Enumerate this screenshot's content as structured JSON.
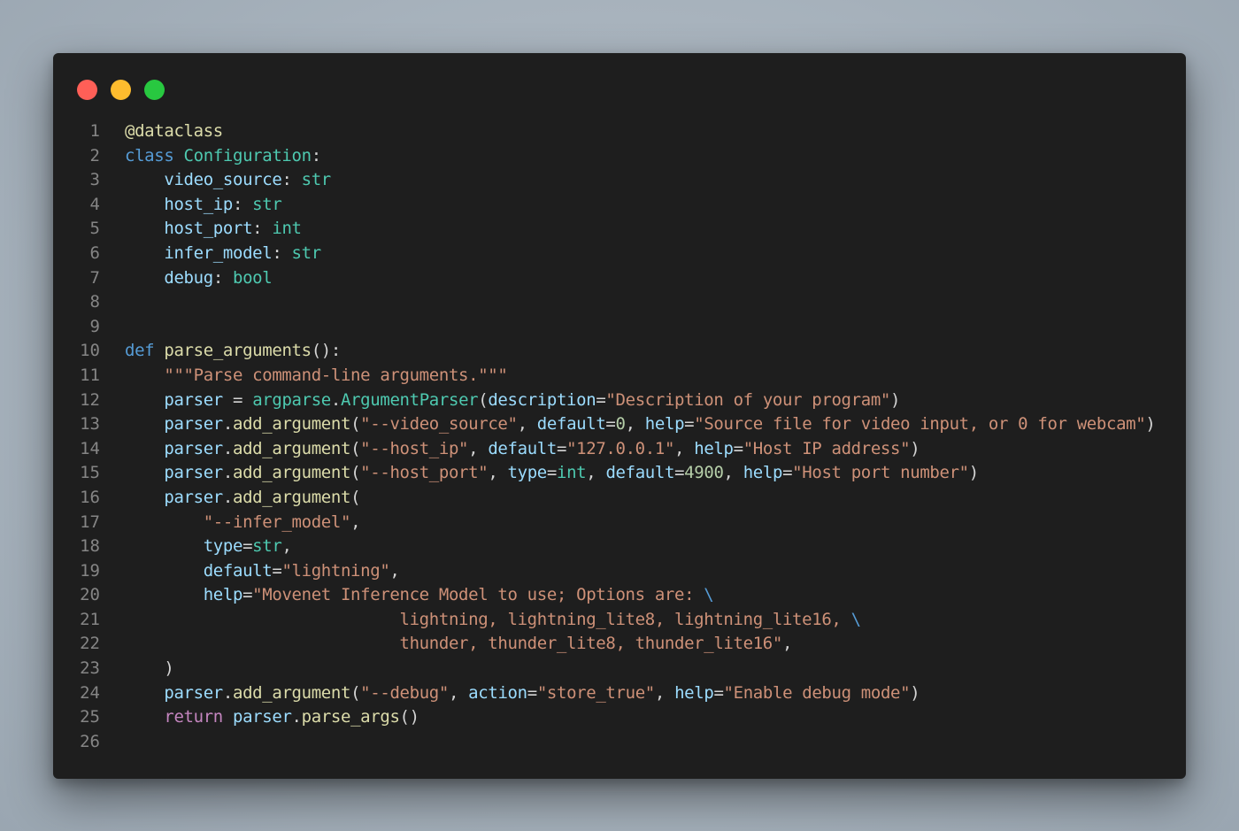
{
  "window": {
    "controls": [
      {
        "name": "close",
        "color": "#ff5f57"
      },
      {
        "name": "minimize",
        "color": "#febc2e"
      },
      {
        "name": "maximize",
        "color": "#28c840"
      }
    ]
  },
  "editor": {
    "language": "python",
    "lines": [
      {
        "n": "1",
        "tokens": [
          [
            "deco",
            "@dataclass"
          ]
        ]
      },
      {
        "n": "2",
        "tokens": [
          [
            "kw",
            "class"
          ],
          [
            "plain",
            " "
          ],
          [
            "cls",
            "Configuration"
          ],
          [
            "plain",
            ":"
          ]
        ]
      },
      {
        "n": "3",
        "tokens": [
          [
            "plain",
            "    "
          ],
          [
            "var",
            "video_source"
          ],
          [
            "plain",
            ": "
          ],
          [
            "type",
            "str"
          ]
        ]
      },
      {
        "n": "4",
        "tokens": [
          [
            "plain",
            "    "
          ],
          [
            "var",
            "host_ip"
          ],
          [
            "plain",
            ": "
          ],
          [
            "type",
            "str"
          ]
        ]
      },
      {
        "n": "5",
        "tokens": [
          [
            "plain",
            "    "
          ],
          [
            "var",
            "host_port"
          ],
          [
            "plain",
            ": "
          ],
          [
            "type",
            "int"
          ]
        ]
      },
      {
        "n": "6",
        "tokens": [
          [
            "plain",
            "    "
          ],
          [
            "var",
            "infer_model"
          ],
          [
            "plain",
            ": "
          ],
          [
            "type",
            "str"
          ]
        ]
      },
      {
        "n": "7",
        "tokens": [
          [
            "plain",
            "    "
          ],
          [
            "var",
            "debug"
          ],
          [
            "plain",
            ": "
          ],
          [
            "type",
            "bool"
          ]
        ]
      },
      {
        "n": "8",
        "tokens": []
      },
      {
        "n": "9",
        "tokens": []
      },
      {
        "n": "10",
        "tokens": [
          [
            "kw",
            "def"
          ],
          [
            "plain",
            " "
          ],
          [
            "fn",
            "parse_arguments"
          ],
          [
            "plain",
            "():"
          ]
        ]
      },
      {
        "n": "11",
        "tokens": [
          [
            "plain",
            "    "
          ],
          [
            "str",
            "\"\"\"Parse command-line arguments.\"\"\""
          ]
        ]
      },
      {
        "n": "12",
        "tokens": [
          [
            "plain",
            "    "
          ],
          [
            "var",
            "parser"
          ],
          [
            "plain",
            " = "
          ],
          [
            "cls",
            "argparse"
          ],
          [
            "plain",
            "."
          ],
          [
            "cls",
            "ArgumentParser"
          ],
          [
            "plain",
            "("
          ],
          [
            "var",
            "description"
          ],
          [
            "plain",
            "="
          ],
          [
            "str",
            "\"Description of your program\""
          ],
          [
            "plain",
            ")"
          ]
        ]
      },
      {
        "n": "13",
        "tokens": [
          [
            "plain",
            "    "
          ],
          [
            "var",
            "parser"
          ],
          [
            "plain",
            "."
          ],
          [
            "fn",
            "add_argument"
          ],
          [
            "plain",
            "("
          ],
          [
            "str",
            "\"--video_source\""
          ],
          [
            "plain",
            ", "
          ],
          [
            "var",
            "default"
          ],
          [
            "plain",
            "="
          ],
          [
            "num",
            "0"
          ],
          [
            "plain",
            ", "
          ],
          [
            "var",
            "help"
          ],
          [
            "plain",
            "="
          ],
          [
            "str",
            "\"Source file for video input, or 0 for webcam\""
          ],
          [
            "plain",
            ")"
          ]
        ]
      },
      {
        "n": "14",
        "tokens": [
          [
            "plain",
            "    "
          ],
          [
            "var",
            "parser"
          ],
          [
            "plain",
            "."
          ],
          [
            "fn",
            "add_argument"
          ],
          [
            "plain",
            "("
          ],
          [
            "str",
            "\"--host_ip\""
          ],
          [
            "plain",
            ", "
          ],
          [
            "var",
            "default"
          ],
          [
            "plain",
            "="
          ],
          [
            "str",
            "\"127.0.0.1\""
          ],
          [
            "plain",
            ", "
          ],
          [
            "var",
            "help"
          ],
          [
            "plain",
            "="
          ],
          [
            "str",
            "\"Host IP address\""
          ],
          [
            "plain",
            ")"
          ]
        ]
      },
      {
        "n": "15",
        "tokens": [
          [
            "plain",
            "    "
          ],
          [
            "var",
            "parser"
          ],
          [
            "plain",
            "."
          ],
          [
            "fn",
            "add_argument"
          ],
          [
            "plain",
            "("
          ],
          [
            "str",
            "\"--host_port\""
          ],
          [
            "plain",
            ", "
          ],
          [
            "var",
            "type"
          ],
          [
            "plain",
            "="
          ],
          [
            "type",
            "int"
          ],
          [
            "plain",
            ", "
          ],
          [
            "var",
            "default"
          ],
          [
            "plain",
            "="
          ],
          [
            "num",
            "4900"
          ],
          [
            "plain",
            ", "
          ],
          [
            "var",
            "help"
          ],
          [
            "plain",
            "="
          ],
          [
            "str",
            "\"Host port number\""
          ],
          [
            "plain",
            ")"
          ]
        ]
      },
      {
        "n": "16",
        "tokens": [
          [
            "plain",
            "    "
          ],
          [
            "var",
            "parser"
          ],
          [
            "plain",
            "."
          ],
          [
            "fn",
            "add_argument"
          ],
          [
            "plain",
            "("
          ]
        ]
      },
      {
        "n": "17",
        "tokens": [
          [
            "plain",
            "        "
          ],
          [
            "str",
            "\"--infer_model\""
          ],
          [
            "plain",
            ","
          ]
        ]
      },
      {
        "n": "18",
        "tokens": [
          [
            "plain",
            "        "
          ],
          [
            "var",
            "type"
          ],
          [
            "plain",
            "="
          ],
          [
            "type",
            "str"
          ],
          [
            "plain",
            ","
          ]
        ]
      },
      {
        "n": "19",
        "tokens": [
          [
            "plain",
            "        "
          ],
          [
            "var",
            "default"
          ],
          [
            "plain",
            "="
          ],
          [
            "str",
            "\"lightning\""
          ],
          [
            "plain",
            ","
          ]
        ]
      },
      {
        "n": "20",
        "tokens": [
          [
            "plain",
            "        "
          ],
          [
            "var",
            "help"
          ],
          [
            "plain",
            "="
          ],
          [
            "str",
            "\"Movenet Inference Model to use; Options are: "
          ],
          [
            "esc",
            "\\"
          ]
        ]
      },
      {
        "n": "21",
        "tokens": [
          [
            "plain",
            "                            "
          ],
          [
            "str",
            "lightning, lightning_lite8, lightning_lite16, "
          ],
          [
            "esc",
            "\\"
          ]
        ]
      },
      {
        "n": "22",
        "tokens": [
          [
            "plain",
            "                            "
          ],
          [
            "str",
            "thunder, thunder_lite8, thunder_lite16\""
          ],
          [
            "plain",
            ","
          ]
        ]
      },
      {
        "n": "23",
        "tokens": [
          [
            "plain",
            "    )"
          ]
        ]
      },
      {
        "n": "24",
        "tokens": [
          [
            "plain",
            "    "
          ],
          [
            "var",
            "parser"
          ],
          [
            "plain",
            "."
          ],
          [
            "fn",
            "add_argument"
          ],
          [
            "plain",
            "("
          ],
          [
            "str",
            "\"--debug\""
          ],
          [
            "plain",
            ", "
          ],
          [
            "var",
            "action"
          ],
          [
            "plain",
            "="
          ],
          [
            "str",
            "\"store_true\""
          ],
          [
            "plain",
            ", "
          ],
          [
            "var",
            "help"
          ],
          [
            "plain",
            "="
          ],
          [
            "str",
            "\"Enable debug mode\""
          ],
          [
            "plain",
            ")"
          ]
        ]
      },
      {
        "n": "25",
        "tokens": [
          [
            "plain",
            "    "
          ],
          [
            "ctrl",
            "return"
          ],
          [
            "plain",
            " "
          ],
          [
            "var",
            "parser"
          ],
          [
            "plain",
            "."
          ],
          [
            "fn",
            "parse_args"
          ],
          [
            "plain",
            "()"
          ]
        ]
      },
      {
        "n": "26",
        "tokens": []
      }
    ]
  }
}
